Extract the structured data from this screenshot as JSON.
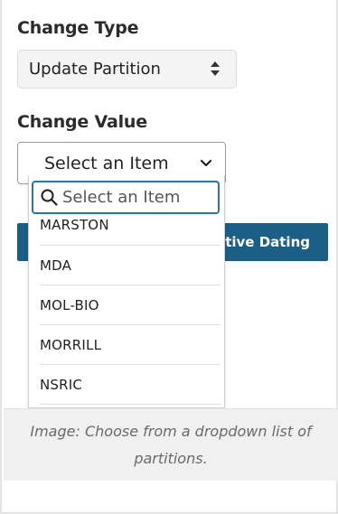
{
  "change_type": {
    "label": "Change Type",
    "selected": "Update Partition"
  },
  "change_value": {
    "label": "Change Value",
    "selected": "Select an Item",
    "search_placeholder": "Select an Item",
    "options": [
      "MARSTON",
      "MDA",
      "MOL-BIO",
      "MORRILL",
      "NSRIC"
    ]
  },
  "background_button": {
    "label": "tive Dating"
  },
  "caption": {
    "text": "Image: Choose from a dropdown list of partitions."
  },
  "colors": {
    "accent": "#1b5e86",
    "focus": "#2f72a8"
  }
}
